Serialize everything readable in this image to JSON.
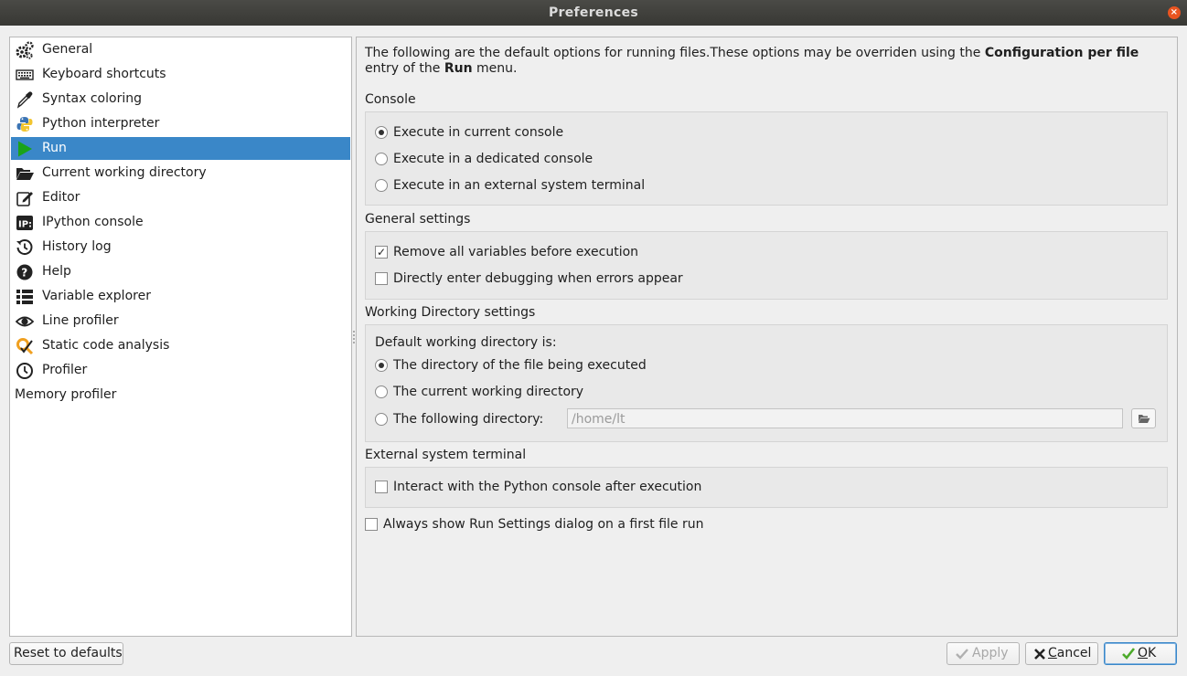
{
  "window": {
    "title": "Preferences",
    "close_glyph": "×"
  },
  "sidebar": {
    "items": [
      {
        "label": "General",
        "icon": "gears-icon"
      },
      {
        "label": "Keyboard shortcuts",
        "icon": "keyboard-icon"
      },
      {
        "label": "Syntax coloring",
        "icon": "eyedropper-icon"
      },
      {
        "label": "Python interpreter",
        "icon": "python-icon"
      },
      {
        "label": "Run",
        "icon": "play-icon",
        "selected": true
      },
      {
        "label": "Current working directory",
        "icon": "folder-open-icon"
      },
      {
        "label": "Editor",
        "icon": "edit-icon"
      },
      {
        "label": "IPython console",
        "icon": "ipython-icon"
      },
      {
        "label": "History log",
        "icon": "history-icon"
      },
      {
        "label": "Help",
        "icon": "help-icon"
      },
      {
        "label": "Variable explorer",
        "icon": "list-icon"
      },
      {
        "label": "Line profiler",
        "icon": "eye-icon"
      },
      {
        "label": "Static code analysis",
        "icon": "code-analysis-icon"
      },
      {
        "label": "Profiler",
        "icon": "clock-icon"
      },
      {
        "label": "Memory profiler",
        "icon": ""
      }
    ]
  },
  "run": {
    "intro_part1": "The following are the default options for running files.These options may be overriden using the ",
    "intro_bold1": "Configuration per file",
    "intro_part2": " entry of the ",
    "intro_bold2": "Run",
    "intro_part3": " menu.",
    "console": {
      "title": "Console",
      "options": [
        {
          "label": "Execute in current console",
          "checked": true
        },
        {
          "label": "Execute in a dedicated console",
          "checked": false
        },
        {
          "label": "Execute in an external system terminal",
          "checked": false
        }
      ]
    },
    "general": {
      "title": "General settings",
      "options": [
        {
          "label": "Remove all variables before execution",
          "checked": true
        },
        {
          "label": "Directly enter debugging when errors appear",
          "checked": false
        }
      ]
    },
    "wdir": {
      "title": "Working Directory settings",
      "subtitle": "Default working directory is:",
      "options": [
        {
          "label": "The directory of the file being executed",
          "checked": true
        },
        {
          "label": "The current working directory",
          "checked": false
        },
        {
          "label": "The following directory:",
          "checked": false
        }
      ],
      "dir_value": "/home/lt"
    },
    "external": {
      "title": "External system terminal",
      "option": {
        "label": "Interact with the Python console after execution",
        "checked": false
      }
    },
    "always_show": {
      "label": "Always show Run Settings dialog on a first file run",
      "checked": false
    }
  },
  "buttons": {
    "reset": "Reset to defaults",
    "apply": "Apply",
    "cancel_c": "C",
    "cancel_rest": "ancel",
    "ok_o": "O",
    "ok_rest": "K"
  },
  "colors": {
    "selection": "#3a87c8",
    "close": "#e95420",
    "play": "#1aa31a"
  }
}
